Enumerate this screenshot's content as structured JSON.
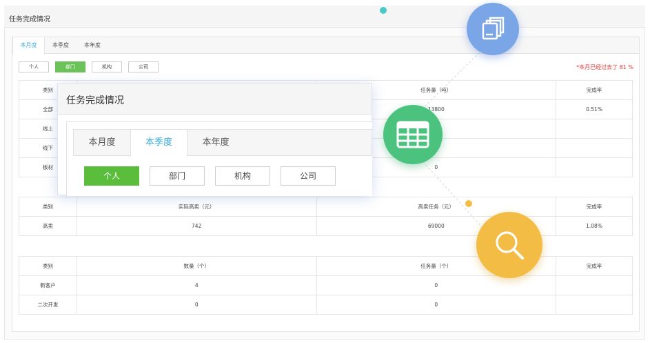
{
  "page": {
    "title": "任务完成情况"
  },
  "tabs": [
    {
      "label": "本月度",
      "active": true
    },
    {
      "label": "本季度",
      "active": false
    },
    {
      "label": "本年度",
      "active": false
    }
  ],
  "scope_buttons": [
    {
      "label": "个人",
      "active": false
    },
    {
      "label": "部门",
      "active": true
    },
    {
      "label": "机构",
      "active": false
    },
    {
      "label": "公司",
      "active": false
    }
  ],
  "notice": "*本月已经过去了 81 %",
  "table1": {
    "headers": [
      "类别",
      "",
      "任务量（吨）",
      "完成率"
    ],
    "rows": [
      [
        "全部",
        "",
        "13800",
        "0.51%"
      ],
      [
        "线上",
        "",
        "",
        ""
      ],
      [
        "线下",
        "",
        "",
        ""
      ],
      [
        "板材",
        "",
        "0",
        ""
      ]
    ]
  },
  "table2": {
    "headers": [
      "类别",
      "实际高卖（元）",
      "高卖任务（元）",
      "完成率"
    ],
    "rows": [
      [
        "高卖",
        "742",
        "69000",
        "1.08%"
      ]
    ]
  },
  "table3": {
    "headers": [
      "类别",
      "数量（个）",
      "任务量（个）",
      "完成率"
    ],
    "rows": [
      [
        "新客户",
        "4",
        "0",
        ""
      ],
      [
        "二次开发",
        "0",
        "0",
        ""
      ]
    ]
  },
  "popup": {
    "title": "任务完成情况",
    "tabs": [
      {
        "label": "本月度",
        "active": false
      },
      {
        "label": "本季度",
        "active": true
      },
      {
        "label": "本年度",
        "active": false
      }
    ],
    "buttons": [
      {
        "label": "个人",
        "active": true
      },
      {
        "label": "部门",
        "active": false
      },
      {
        "label": "机构",
        "active": false
      },
      {
        "label": "公司",
        "active": false
      }
    ]
  },
  "colors": {
    "accent_blue": "#3aa8d8",
    "active_green": "#6ac259",
    "notice_red": "#e53935",
    "copy_circle": "#7aa6e8",
    "table_circle": "#4cc27f",
    "search_circle": "#f3bd45"
  },
  "icons": {
    "copy": "copy-icon",
    "table": "table-icon",
    "search": "search-icon"
  }
}
